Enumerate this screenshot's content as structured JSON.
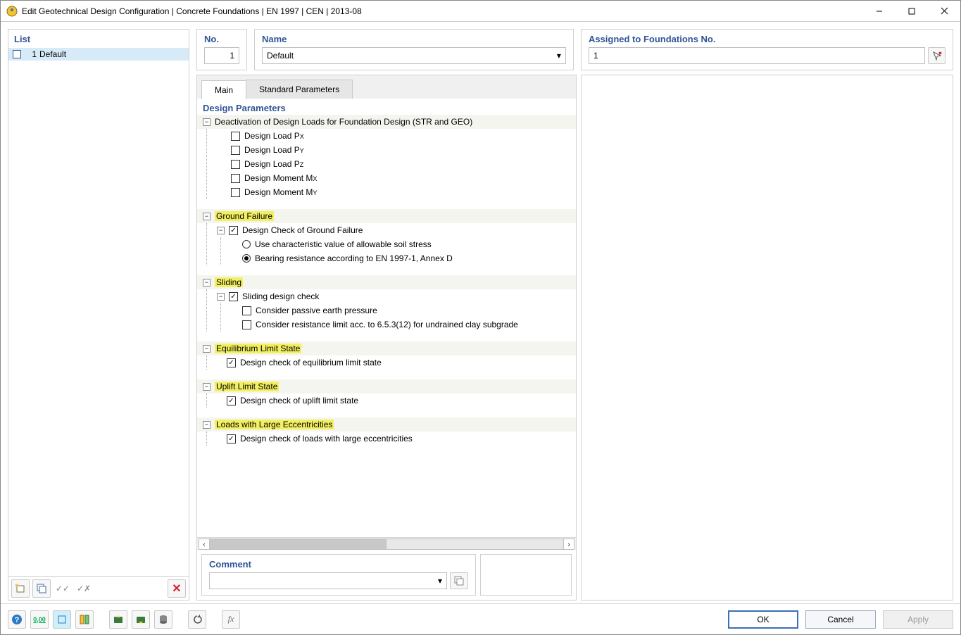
{
  "window": {
    "title": "Edit Geotechnical Design Configuration | Concrete Foundations | EN 1997 | CEN | 2013-08"
  },
  "leftPanel": {
    "title": "List",
    "items": [
      {
        "num": "1",
        "label": "Default"
      }
    ]
  },
  "header": {
    "noLabel": "No.",
    "noValue": "1",
    "nameLabel": "Name",
    "nameValue": "Default",
    "assignedLabel": "Assigned to Foundations No.",
    "assignedValue": "1"
  },
  "tabs": {
    "main": "Main",
    "std": "Standard Parameters"
  },
  "params": {
    "title": "Design Parameters",
    "deact": {
      "group": "Deactivation of Design Loads for Foundation Design (STR and GEO)",
      "px": "Design Load P",
      "px_sub": "X",
      "py": "Design Load P",
      "py_sub": "Y",
      "pz": "Design Load P",
      "pz_sub": "Z",
      "mx": "Design Moment M",
      "mx_sub": "X",
      "my": "Design Moment M",
      "my_sub": "Y"
    },
    "gf": {
      "group": "Ground Failure",
      "check": "Design Check of Ground Failure",
      "r1": "Use characteristic value of allowable soil stress",
      "r2": "Bearing resistance according to EN 1997-1, Annex D"
    },
    "slid": {
      "group": "Sliding",
      "check": "Sliding design check",
      "c1": "Consider passive earth pressure",
      "c2": "Consider resistance limit acc. to 6.5.3(12) for undrained clay subgrade"
    },
    "eq": {
      "group": "Equilibrium Limit State",
      "check": "Design check of equilibrium limit state"
    },
    "up": {
      "group": "Uplift Limit State",
      "check": "Design check of uplift limit state"
    },
    "ecc": {
      "group": "Loads with Large Eccentricities",
      "check": "Design check of loads with large eccentricities"
    }
  },
  "comment": {
    "label": "Comment",
    "value": ""
  },
  "footer": {
    "ok": "OK",
    "cancel": "Cancel",
    "apply": "Apply"
  }
}
